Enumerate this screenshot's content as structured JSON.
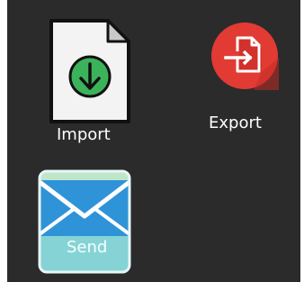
{
  "desktop": {
    "background_color": "#2b2b2b",
    "icons": [
      {
        "label": "Import",
        "icon": "import-document-icon",
        "accent": "#3cb35b"
      },
      {
        "label": "Export",
        "icon": "export-icon",
        "accent": "#e23b34"
      },
      {
        "label": "Send",
        "icon": "send-mail-icon",
        "accent": "#2b8fd6"
      }
    ]
  }
}
